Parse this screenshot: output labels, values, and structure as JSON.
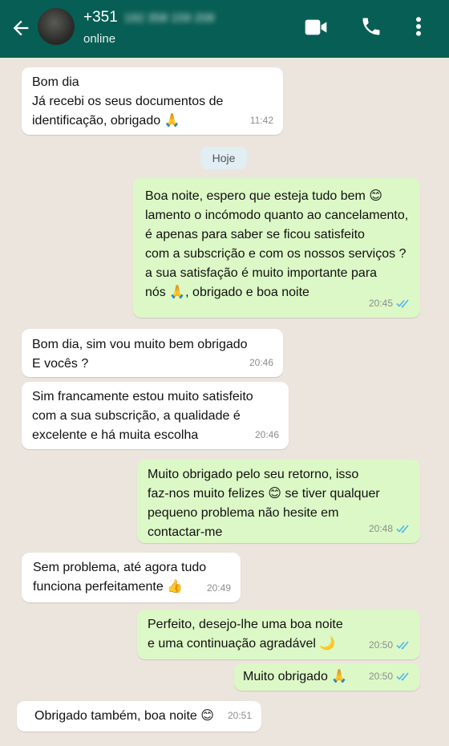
{
  "header": {
    "contact_code": "+351",
    "contact_number_hidden": "192 358 159 208",
    "status": "online",
    "icons": [
      "back-arrow-icon",
      "video-call-icon",
      "phone-call-icon",
      "more-options-icon"
    ]
  },
  "day_divider": "Hoje",
  "colors": {
    "header": "#075e54",
    "incoming": "#ffffff",
    "outgoing": "#dcf8c6",
    "background": "#ece5dd",
    "read_ticks": "#4fb6ec"
  },
  "messages": [
    {
      "direction": "in",
      "text": "Bom dia\nJá recebi os seus documentos de\nidentificação, obrigado 🙏",
      "time": "11:42"
    },
    {
      "direction": "out",
      "text": "Boa noite, espero que esteja tudo bem 😊\nlamento o incómodo quanto ao cancelamento,\né apenas para saber se ficou satisfeito\ncom a subscrição e com os nossos serviços ?\na sua satisfação é muito importante para\nnós 🙏, obrigado e boa noite",
      "time": "20:45",
      "status": "read"
    },
    {
      "direction": "in",
      "text": "Bom dia, sim vou muito bem obrigado\nE vocês ?",
      "time": "20:46"
    },
    {
      "direction": "in",
      "text": "Sim francamente estou muito satisfeito\ncom a sua subscrição, a qualidade é\nexcelente e há muita escolha",
      "time": "20:46"
    },
    {
      "direction": "out",
      "text": "Muito obrigado pelo seu  retorno, isso\nfaz-nos muito felizes 😊 se tiver qualquer\npequeno problema não hesite em\ncontactar-me",
      "time": "20:48",
      "status": "read"
    },
    {
      "direction": "in",
      "text": "Sem problema, até agora tudo\nfunciona perfeitamente 👍",
      "time": "20:49"
    },
    {
      "direction": "out",
      "text": "Perfeito, desejo-lhe uma boa noite\ne uma continuação agradável 🌙",
      "time": "20:50",
      "status": "read"
    },
    {
      "direction": "out",
      "text": "Muito obrigado 🙏",
      "time": "20:50",
      "status": "read"
    },
    {
      "direction": "in",
      "text": "Obrigado também, boa noite 😊",
      "time": "20:51"
    }
  ]
}
